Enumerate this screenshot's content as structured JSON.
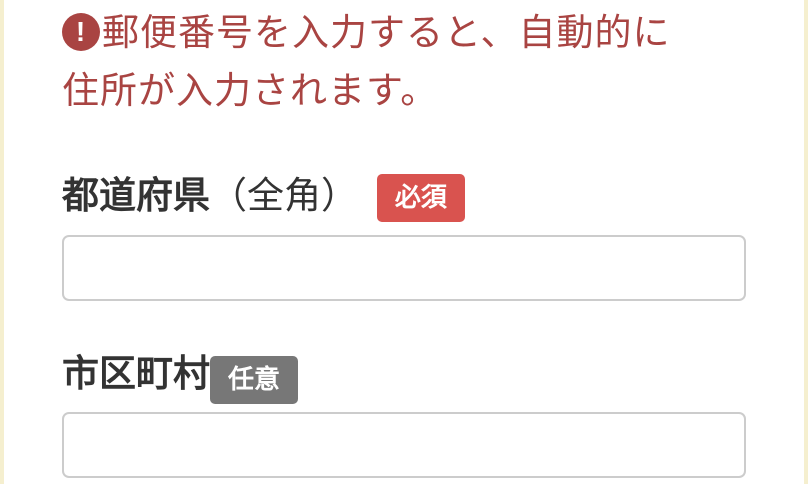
{
  "notice": {
    "icon": "exclamation-circle-icon",
    "line1": "郵便番号を入力すると、自動的に",
    "line2": "住所が入力されます。"
  },
  "fields": {
    "prefecture": {
      "label": "都道府県",
      "sublabel": "（全角）",
      "badge": "必須",
      "value": ""
    },
    "city": {
      "label": "市区町村",
      "badge": "任意",
      "value": ""
    }
  },
  "colors": {
    "notice": "#a94442",
    "required_badge": "#d9534f",
    "optional_badge": "#777777",
    "label_text": "#333333",
    "input_border": "#cccccc",
    "side_border": "#f5efcf"
  }
}
